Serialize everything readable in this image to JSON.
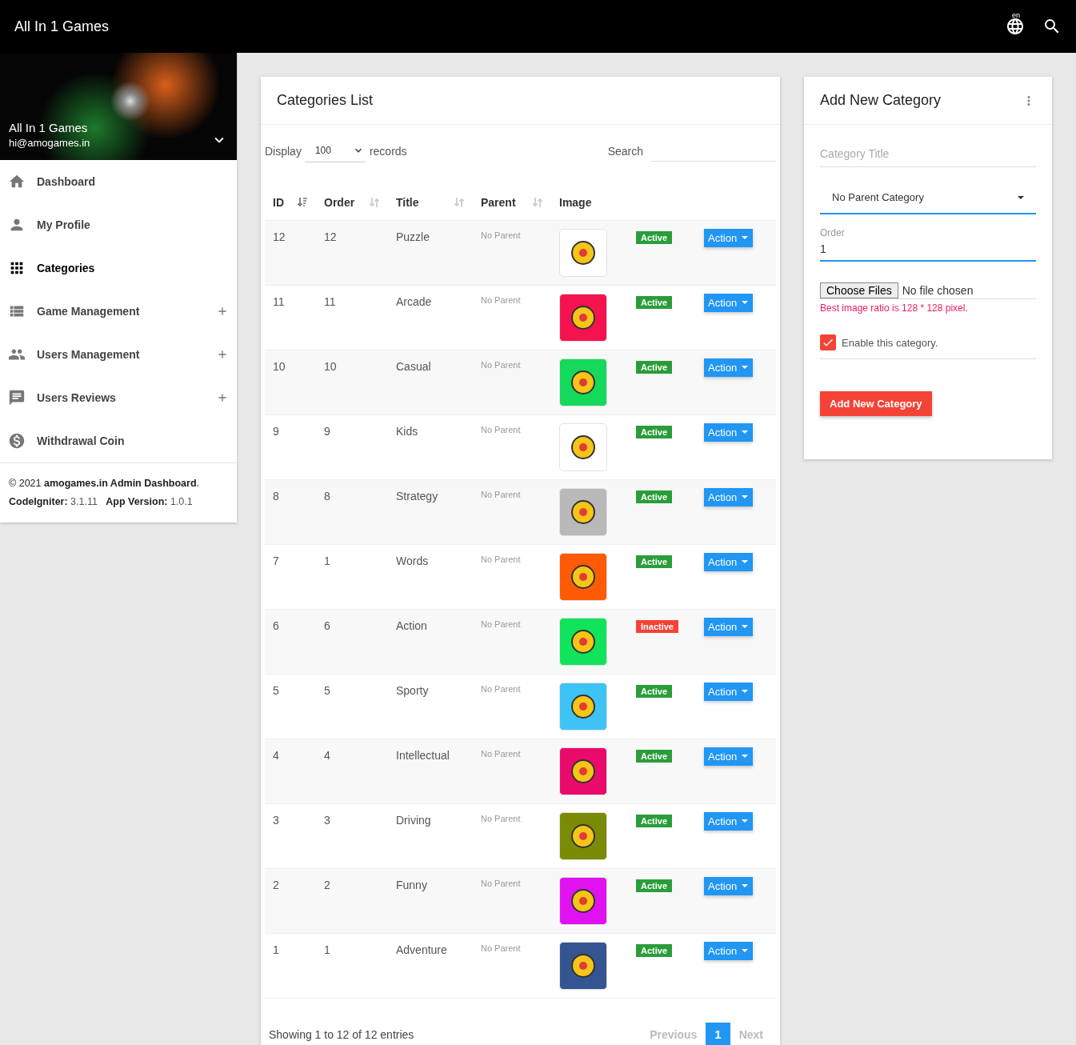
{
  "topbar": {
    "title": "All In 1 Games",
    "language": "en"
  },
  "sidebar": {
    "profile": {
      "name": "All In 1 Games",
      "email": "hi@amogames.in"
    },
    "items": [
      {
        "label": "Dashboard",
        "selected": false,
        "expandable": false
      },
      {
        "label": "My Profile",
        "selected": false,
        "expandable": false
      },
      {
        "label": "Categories",
        "selected": true,
        "expandable": false
      },
      {
        "label": "Game Management",
        "selected": false,
        "expandable": true
      },
      {
        "label": "Users Management",
        "selected": false,
        "expandable": true
      },
      {
        "label": "Users Reviews",
        "selected": false,
        "expandable": true
      },
      {
        "label": "Withdrawal Coin",
        "selected": false,
        "expandable": false
      }
    ],
    "footer": {
      "copyright": "© 2021 **amogames.in Admin Dashboard**.",
      "framework_label": "CodeIgniter:",
      "framework_version": "3.1.11",
      "app_label": "App Version:",
      "app_version": "1.0.1"
    }
  },
  "categories_list": {
    "title": "Categories List",
    "display_label": "Display",
    "page_size": "100",
    "records_label": "records",
    "search_label": "Search",
    "columns": [
      {
        "label": "ID",
        "sorted": true
      },
      {
        "label": "Order",
        "sorted": false
      },
      {
        "label": "Title",
        "sorted": false
      },
      {
        "label": "Parent",
        "sorted": false
      },
      {
        "label": "Image"
      }
    ],
    "rows": [
      {
        "id": "12",
        "order": "12",
        "title": "Puzzle",
        "parent": "No Parent",
        "color": "#ffffff",
        "status": "Active",
        "active": true,
        "action": "Action"
      },
      {
        "id": "11",
        "order": "11",
        "title": "Arcade",
        "parent": "No Parent",
        "color": "#f5134f",
        "status": "Active",
        "active": true,
        "action": "Action"
      },
      {
        "id": "10",
        "order": "10",
        "title": "Casual",
        "parent": "No Parent",
        "color": "#14d95a",
        "status": "Active",
        "active": true,
        "action": "Action"
      },
      {
        "id": "9",
        "order": "9",
        "title": "Kids",
        "parent": "No Parent",
        "color": "#ffffff",
        "status": "Active",
        "active": true,
        "action": "Action"
      },
      {
        "id": "8",
        "order": "8",
        "title": "Strategy",
        "parent": "No Parent",
        "color": "#b9b9b9",
        "status": "Active",
        "active": true,
        "action": "Action"
      },
      {
        "id": "7",
        "order": "1",
        "title": "Words",
        "parent": "No Parent",
        "color": "#ff5a06",
        "status": "Active",
        "active": true,
        "action": "Action"
      },
      {
        "id": "6",
        "order": "6",
        "title": "Action",
        "parent": "No Parent",
        "color": "#11e35a",
        "status": "Inactive",
        "active": false,
        "action": "Action"
      },
      {
        "id": "5",
        "order": "5",
        "title": "Sporty",
        "parent": "No Parent",
        "color": "#3ec3f5",
        "status": "Active",
        "active": true,
        "action": "Action"
      },
      {
        "id": "4",
        "order": "4",
        "title": "Intellectual",
        "parent": "No Parent",
        "color": "#ea0a6b",
        "status": "Active",
        "active": true,
        "action": "Action"
      },
      {
        "id": "3",
        "order": "3",
        "title": "Driving",
        "parent": "No Parent",
        "color": "#7a8b05",
        "status": "Active",
        "active": true,
        "action": "Action"
      },
      {
        "id": "2",
        "order": "2",
        "title": "Funny",
        "parent": "No Parent",
        "color": "#e012ef",
        "status": "Active",
        "active": true,
        "action": "Action"
      },
      {
        "id": "1",
        "order": "1",
        "title": "Adventure",
        "parent": "No Parent",
        "color": "#345591",
        "status": "Active",
        "active": true,
        "action": "Action"
      }
    ],
    "summary": "Showing 1 to 12 of 12 entries",
    "pagination": [
      {
        "label": "Previous",
        "kind": "nav",
        "selected": false
      },
      {
        "label": "1",
        "kind": "page",
        "selected": true
      },
      {
        "label": "Next",
        "kind": "nav",
        "selected": false
      }
    ]
  },
  "add_category": {
    "title": "Add New Category",
    "title_placeholder": "Category Title",
    "parent_value": "No Parent Category",
    "order_label": "Order",
    "order_value": "1",
    "file_button": "Choose Files",
    "file_status": "No file chosen",
    "hint": "Best image ratio is 128 * 128 pixel.",
    "enable_label": "Enable this category.",
    "enabled": true,
    "submit": "Add New Category"
  }
}
